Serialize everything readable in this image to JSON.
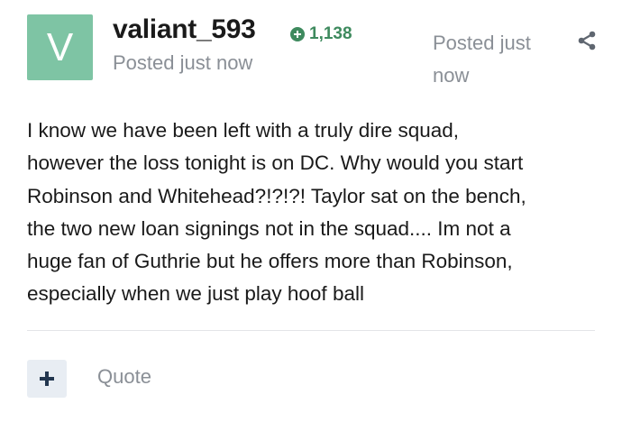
{
  "author": {
    "avatar_letter": "V",
    "avatar_color": "#7ec4a4",
    "username": "valiant_593",
    "reputation": "1,138",
    "reputation_color": "#3e8a5e",
    "posted_label": "Posted just now"
  },
  "meta": {
    "posted_label": "Posted just now",
    "share_icon": "share-icon"
  },
  "post": {
    "body": "I know we have been left with a truly dire squad,\nhowever the loss tonight is on DC. Why would you start\nRobinson and Whitehead?!?!?!  Taylor sat on the bench,\nthe two new loan signings not in the squad.... Im not a\nhuge fan of Guthrie but he offers more than Robinson,\nespecially when we just play hoof ball"
  },
  "actions": {
    "plus_icon": "plus-icon",
    "quote_label": "Quote"
  }
}
